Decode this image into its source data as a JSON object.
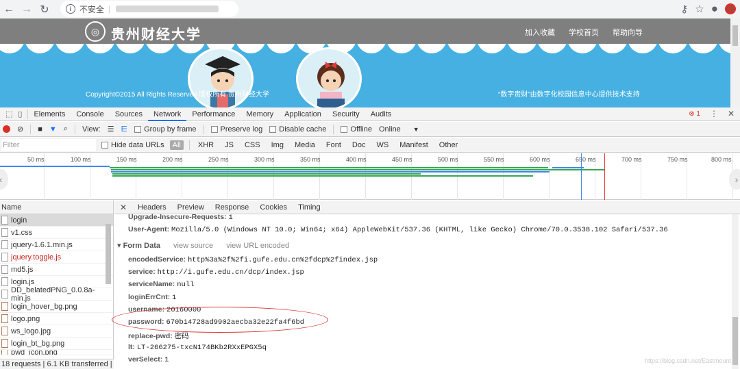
{
  "browser": {
    "security_label": "不安全",
    "icons": [
      "back-icon",
      "forward-icon",
      "reload-icon",
      "info-icon",
      "key-icon",
      "star-icon",
      "account-icon",
      "extension-icon"
    ]
  },
  "site": {
    "name": "贵州财经大学",
    "links": [
      "加入收藏",
      "学校首页",
      "帮助向导"
    ],
    "copyright": "Copyright©2015  All Rights Reserved  版权所有 贵州财经大学",
    "support": "“数字贵财”由数字化校园信息中心提供技术支持",
    "colors": {
      "header": "#7f7f7f",
      "banner": "#45b0e1"
    }
  },
  "devtools": {
    "tabs": [
      "Elements",
      "Console",
      "Sources",
      "Network",
      "Performance",
      "Memory",
      "Application",
      "Security",
      "Audits"
    ],
    "active_tab": "Network",
    "error_count": "1",
    "toolbar": {
      "view_label": "View:",
      "group_by_frame": "Group by frame",
      "preserve_log": "Preserve log",
      "disable_cache": "Disable cache",
      "offline": "Offline",
      "throttle": "Online"
    },
    "filter": {
      "placeholder": "Filter",
      "hide_data_urls": "Hide data URLs",
      "types": [
        "All",
        "XHR",
        "JS",
        "CSS",
        "Img",
        "Media",
        "Font",
        "Doc",
        "WS",
        "Manifest",
        "Other"
      ]
    },
    "timeline_ticks": [
      "50 ms",
      "100 ms",
      "150 ms",
      "200 ms",
      "250 ms",
      "300 ms",
      "350 ms",
      "400 ms",
      "450 ms",
      "500 ms",
      "550 ms",
      "600 ms",
      "650 ms",
      "700 ms",
      "750 ms",
      "800 ms"
    ],
    "name_header": "Name",
    "requests": [
      {
        "name": "login",
        "type": "doc"
      },
      {
        "name": "v1.css",
        "type": "doc"
      },
      {
        "name": "jquery-1.6.1.min.js",
        "type": "doc"
      },
      {
        "name": "jquery.toggle.js",
        "type": "doc",
        "error": true
      },
      {
        "name": "md5.js",
        "type": "doc"
      },
      {
        "name": "login.js",
        "type": "doc"
      },
      {
        "name": "DD_belatedPNG_0.0.8a-min.js",
        "type": "doc"
      },
      {
        "name": "login_hover_bg.png",
        "type": "img"
      },
      {
        "name": "logo.png",
        "type": "img"
      },
      {
        "name": "ws_logo.jpg",
        "type": "img"
      },
      {
        "name": "login_bt_bg.png",
        "type": "img"
      },
      {
        "name": "pwd_icon.png",
        "type": "img"
      }
    ],
    "summary": "18 requests | 6.1 KB transferred | ...",
    "detail_tabs": [
      "Headers",
      "Preview",
      "Response",
      "Cookies",
      "Timing"
    ],
    "headers": [
      {
        "key": "Upgrade-Insecure-Requests:",
        "value": "1"
      },
      {
        "key": "User-Agent:",
        "value": "Mozilla/5.0 (Windows NT 10.0; Win64; x64) AppleWebKit/537.36 (KHTML, like Gecko) Chrome/70.0.3538.102 Safari/537.36"
      }
    ],
    "form_data": {
      "title": "▾ Form Data",
      "view_source": "view source",
      "view_url_encoded": "view URL encoded",
      "fields": [
        {
          "key": "encodedService:",
          "value": "http%3a%2f%2fi.gufe.edu.cn%2fdcp%2findex.jsp"
        },
        {
          "key": "service:",
          "value": "http://i.gufe.edu.cn/dcp/index.jsp"
        },
        {
          "key": "serviceName:",
          "value": "null"
        },
        {
          "key": "loginErrCnt:",
          "value": "1"
        },
        {
          "key": "username:",
          "value": "20160000"
        },
        {
          "key": "password:",
          "value": "670b14728ad9902aecba32e22fa4f6bd"
        },
        {
          "key": "replace-pwd:",
          "value": "密码"
        },
        {
          "key": "lt:",
          "value": "LT-266275-txcN174BKb2RXxEPGX5q"
        },
        {
          "key": "verSelect:",
          "value": "1"
        }
      ]
    },
    "watermark": "https://blog.csdn.net/Eastmount"
  }
}
